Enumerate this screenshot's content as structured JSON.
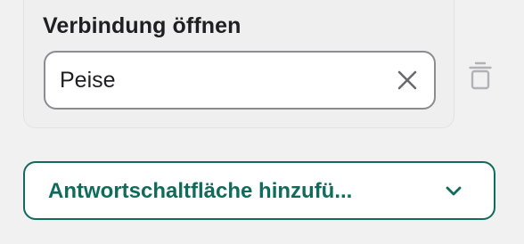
{
  "card": {
    "label": "Verbindung öffnen",
    "input_value": "Peise"
  },
  "icons": {
    "clear": "close-icon",
    "delete": "trash-icon",
    "expand": "chevron-down-icon"
  },
  "add_button": {
    "label": "Antwortschaltfläche hinzufü..."
  },
  "colors": {
    "accent": "#0f6b5b",
    "text": "#1f1f22",
    "background": "#f1f1f2"
  }
}
